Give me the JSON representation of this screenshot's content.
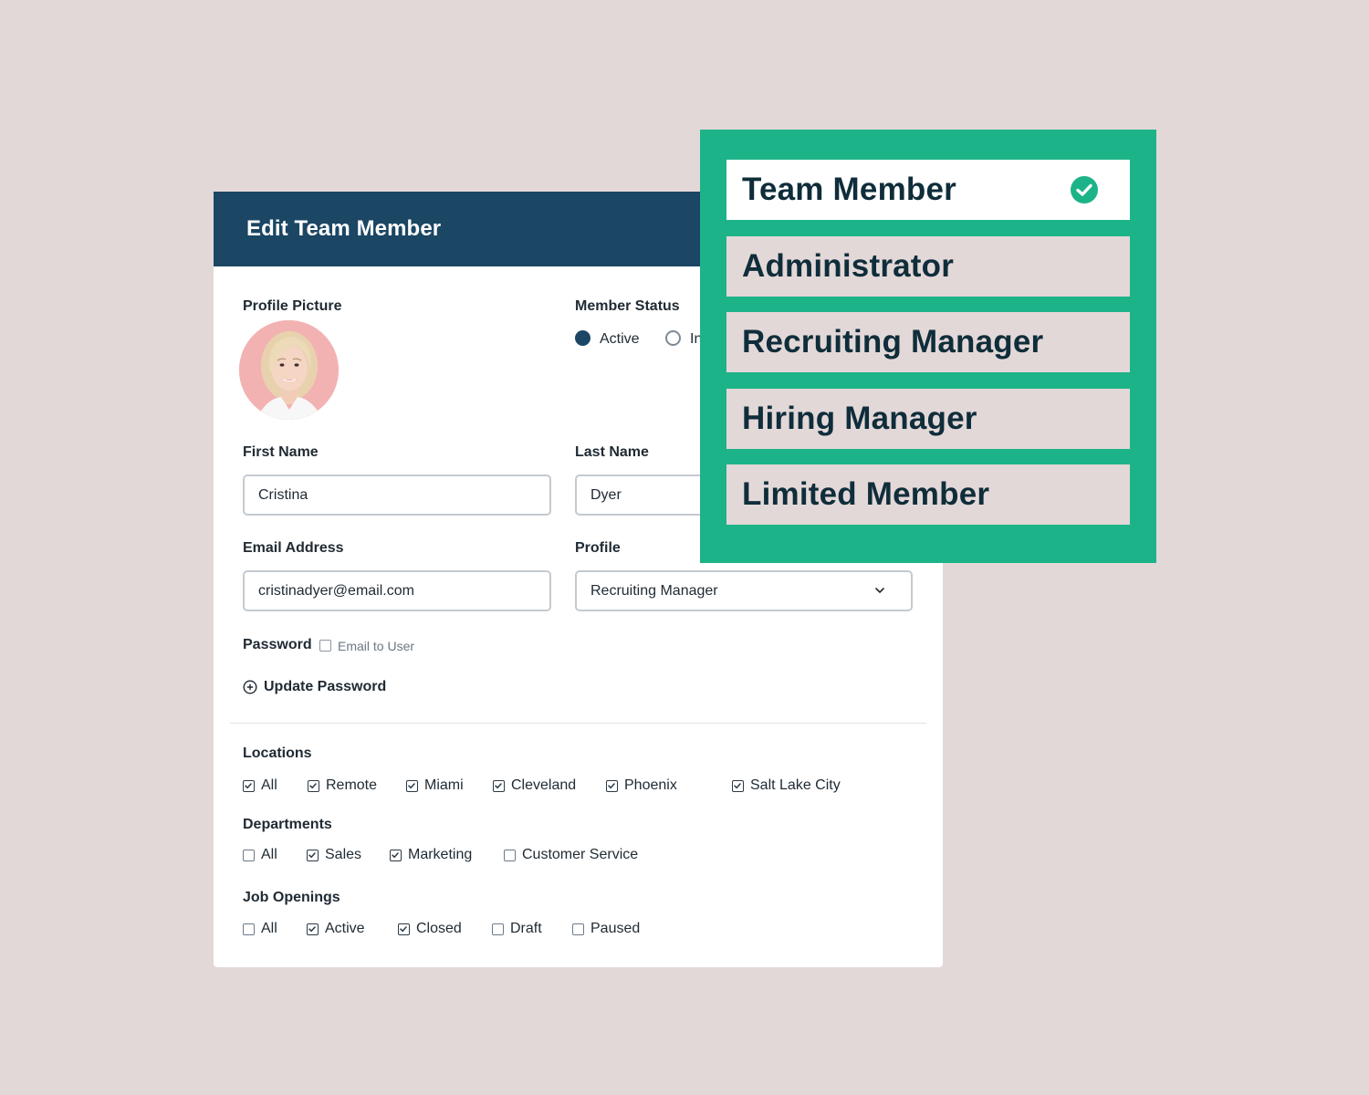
{
  "colors": {
    "background": "#e3d8d8",
    "header": "#1b4664",
    "panel": "#1db388",
    "text": "#1f2a33"
  },
  "form": {
    "title": "Edit Team Member",
    "profile_picture_label": "Profile Picture",
    "member_status": {
      "label": "Member Status",
      "options": [
        {
          "label": "Active",
          "selected": true
        },
        {
          "label": "In",
          "selected": false
        }
      ]
    },
    "first_name": {
      "label": "First Name",
      "value": "Cristina"
    },
    "last_name": {
      "label": "Last Name",
      "value": "Dyer"
    },
    "email": {
      "label": "Email Address",
      "value": "cristinadyer@email.com"
    },
    "profile": {
      "label": "Profile",
      "value": "Recruiting Manager",
      "icon": "chevron-down-icon"
    },
    "password": {
      "label": "Password",
      "email_to_user": "Email to User",
      "update_label": "Update Password",
      "update_icon": "plus-circle-icon"
    },
    "locations": {
      "label": "Locations",
      "items": [
        {
          "label": "All",
          "checked": true
        },
        {
          "label": "Remote",
          "checked": true
        },
        {
          "label": "Miami",
          "checked": true
        },
        {
          "label": "Cleveland",
          "checked": true
        },
        {
          "label": "Phoenix",
          "checked": true
        },
        {
          "label": "Salt Lake City",
          "checked": true
        }
      ]
    },
    "departments": {
      "label": "Departments",
      "items": [
        {
          "label": "All",
          "checked": false
        },
        {
          "label": "Sales",
          "checked": true
        },
        {
          "label": "Marketing",
          "checked": true
        },
        {
          "label": "Customer Service",
          "checked": false
        }
      ]
    },
    "job_openings": {
      "label": "Job Openings",
      "items": [
        {
          "label": "All",
          "checked": false
        },
        {
          "label": "Active",
          "checked": true
        },
        {
          "label": "Closed",
          "checked": true
        },
        {
          "label": "Draft",
          "checked": false
        },
        {
          "label": "Paused",
          "checked": false
        }
      ]
    }
  },
  "roles_dropdown": {
    "options": [
      {
        "label": "Team Member",
        "selected": true,
        "icon": "check-circle-icon"
      },
      {
        "label": "Administrator",
        "selected": false
      },
      {
        "label": "Recruiting Manager",
        "selected": false
      },
      {
        "label": "Hiring Manager",
        "selected": false
      },
      {
        "label": "Limited Member",
        "selected": false
      }
    ]
  }
}
